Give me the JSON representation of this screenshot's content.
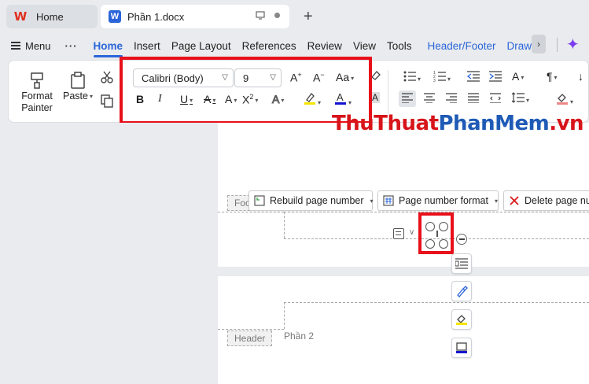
{
  "tabs": {
    "home_label": "Home",
    "doc_label": "Phần 1.docx"
  },
  "menu": {
    "menu_label": "Menu",
    "more": "···",
    "items": [
      "Home",
      "Insert",
      "Page Layout",
      "References",
      "Review",
      "View",
      "Tools",
      "Header/Footer",
      "Draw"
    ]
  },
  "ribbon": {
    "format_painter": "Format Painter",
    "paste": "Paste",
    "font_name": "Calibri (Body)",
    "font_size": "9"
  },
  "watermark": {
    "part1": "Thu",
    "part2": "Thuat",
    "part3": "Phan",
    "part4": "Mem",
    "part5": ".vn"
  },
  "header_footer": {
    "rebuild": "Rebuild page number",
    "page_number_format": "Page number format",
    "delete": "Delete page nu",
    "footer_tag": "Foo",
    "header_tag": "Header",
    "section_label": "Phần 2"
  },
  "colors": {
    "accent": "#2b65d9",
    "highlight_red": "#e8101b",
    "watermark_red": "#d7141a",
    "watermark_blue": "#1e5ab6"
  }
}
